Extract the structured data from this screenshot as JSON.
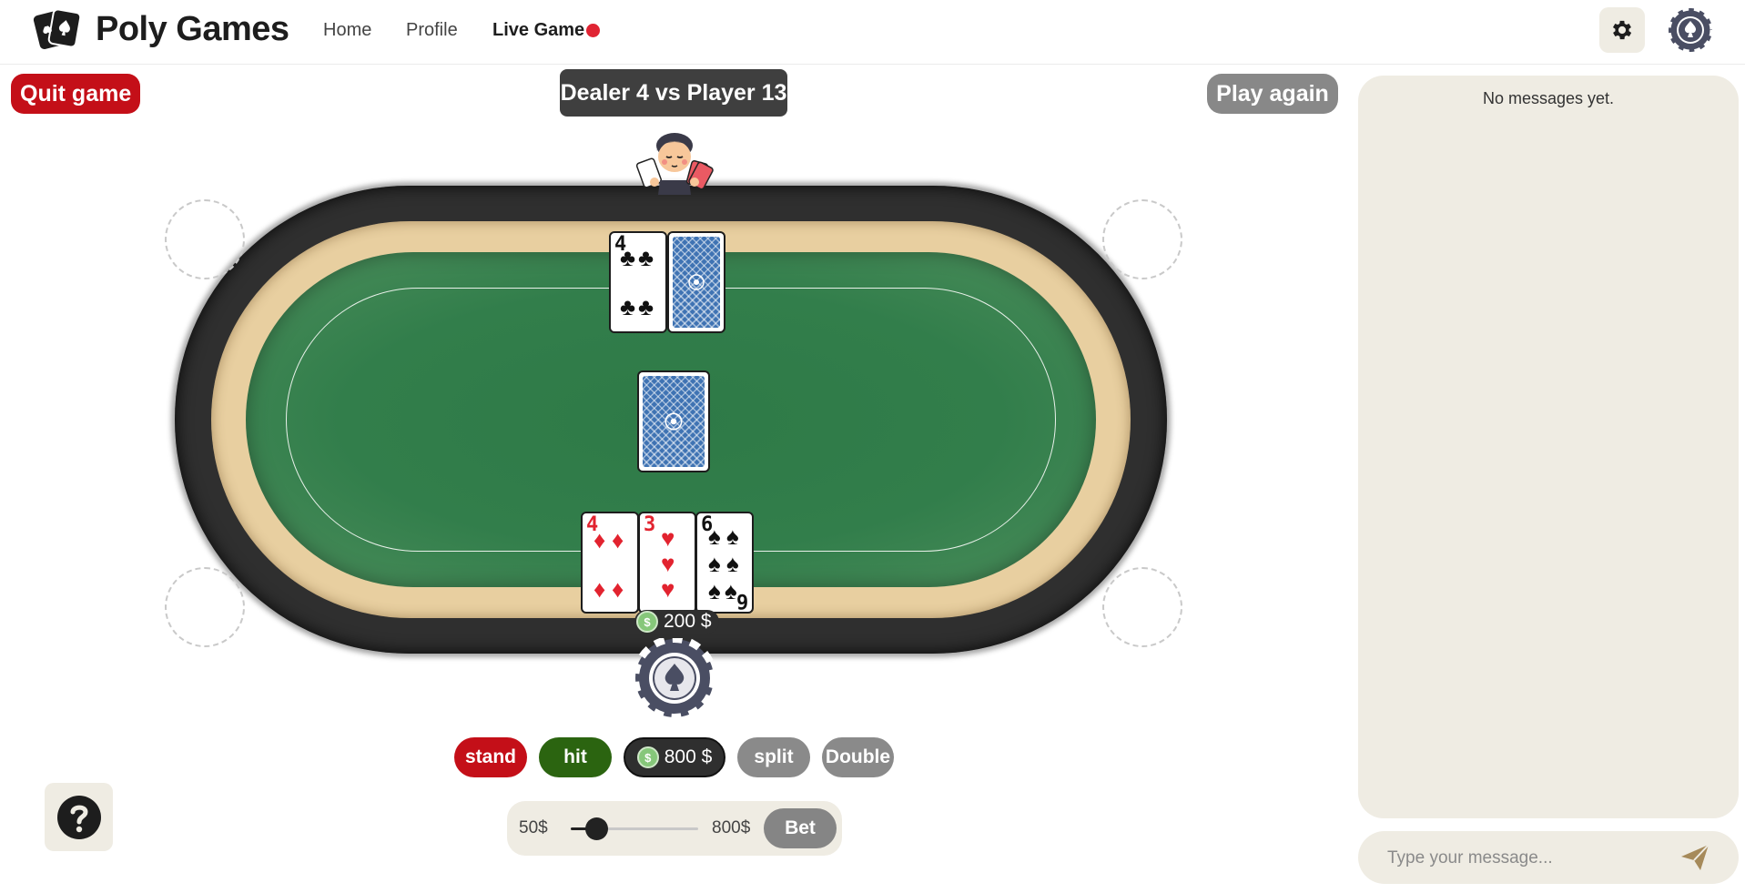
{
  "app": {
    "brand": "Poly Games",
    "nav": {
      "home": "Home",
      "profile": "Profile",
      "live_game": "Live Game"
    },
    "icons": {
      "logo": "cards-logo-icon",
      "settings": "gear-icon",
      "avatar": "spade-chip-avatar-icon",
      "live": "live-indicator-dot"
    }
  },
  "game": {
    "quit_label": "Quit game",
    "title": "Dealer 4 vs Player 13",
    "play_again_label": "Play again",
    "dealer_hand": [
      {
        "rank": "4",
        "suit": "clubs",
        "face_up": true
      },
      {
        "rank": "",
        "suit": "",
        "face_up": false
      }
    ],
    "deck": {
      "face_up": false
    },
    "player_hand": [
      {
        "rank": "4",
        "suit": "diamonds",
        "face_up": true
      },
      {
        "rank": "3",
        "suit": "hearts",
        "face_up": true
      },
      {
        "rank": "6",
        "suit": "spades",
        "face_up": true
      }
    ],
    "current_bet": "200 $",
    "colors": {
      "felt": "#2e7a47",
      "rail": "#2f2f2f",
      "wood": "#e8cfa0",
      "danger": "#c40f18",
      "success": "#2b6410",
      "muted": "#8a8a8a"
    }
  },
  "actions": {
    "stand": "stand",
    "hit": "hit",
    "balance": "800 $",
    "split": "split",
    "double": "Double"
  },
  "bet": {
    "min_label": "50$",
    "max_label": "800$",
    "min": 50,
    "max": 800,
    "value": 200,
    "button": "Bet"
  },
  "help": {
    "icon": "question-mark-icon"
  },
  "chat": {
    "empty_text": "No messages yet.",
    "placeholder": "Type your message...",
    "send_icon": "send-icon"
  }
}
